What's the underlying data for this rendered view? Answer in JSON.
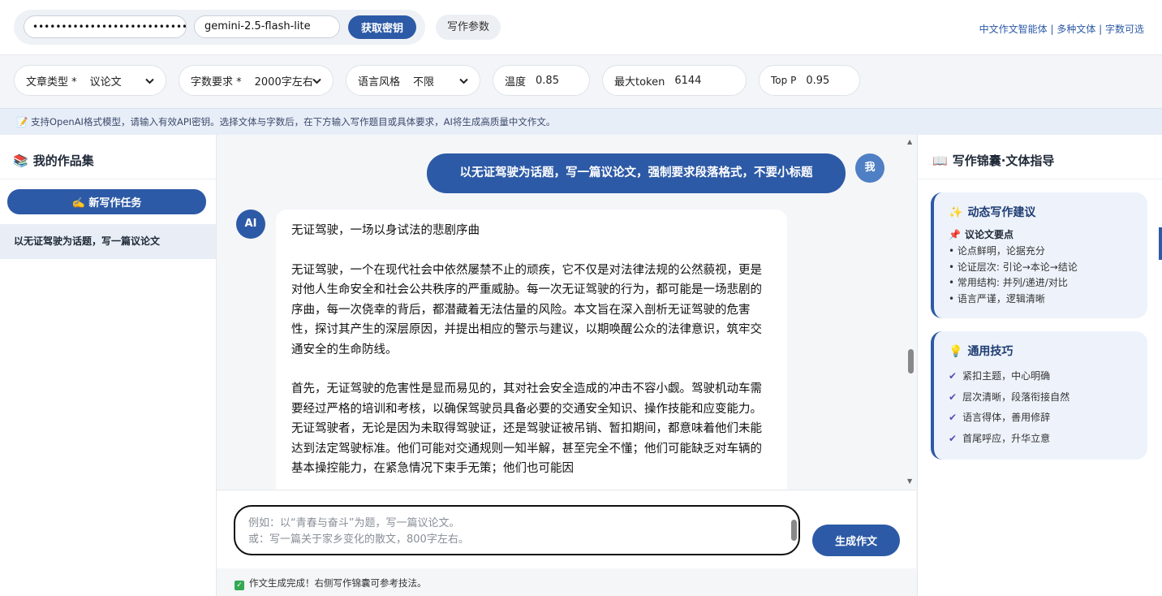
{
  "header": {
    "api_key_masked": "••••••••••••••••••••••••••••••••••••••",
    "model": "gemini-2.5-flash-lite",
    "get_key_label": "获取密钥",
    "params_label": "写作参数",
    "brand_tags": "中文作文智能体 | 多种文体 | 字数可选"
  },
  "settings": {
    "type_label": "文章类型 *",
    "type_value": "议论文",
    "words_label": "字数要求 *",
    "words_value": "2000字左右",
    "style_label": "语言风格",
    "style_value": "不限",
    "temp_label": "温度",
    "temp_value": "0.85",
    "maxtoken_label": "最大token",
    "maxtoken_value": "6144",
    "topp_label": "Top P",
    "topp_value": "0.95"
  },
  "note": "📝 支持OpenAI格式模型，请输入有效API密钥。选择文体与字数后，在下方输入写作题目或具体要求，AI将生成高质量中文作文。",
  "sidebar": {
    "title": "我的作品集",
    "new_task_label": "✍️ 新写作任务",
    "items": [
      {
        "label": "以无证驾驶为话题，写一篇议论文"
      }
    ]
  },
  "chat": {
    "user_avatar": "我",
    "ai_avatar": "AI",
    "user_message": "以无证驾驶为话题，写一篇议论文，强制要求段落格式，不要小标题",
    "ai_title": "无证驾驶，一场以身试法的悲剧序曲",
    "ai_paragraphs": [
      "无证驾驶，一个在现代社会中依然屡禁不止的顽疾，它不仅是对法律法规的公然藐视，更是对他人生命安全和社会公共秩序的严重威胁。每一次无证驾驶的行为，都可能是一场悲剧的序曲，每一次侥幸的背后，都潜藏着无法估量的风险。本文旨在深入剖析无证驾驶的危害性，探讨其产生的深层原因，并提出相应的警示与建议，以期唤醒公众的法律意识，筑牢交通安全的生命防线。",
      "首先，无证驾驶的危害性是显而易见的，其对社会安全造成的冲击不容小觑。驾驶机动车需要经过严格的培训和考核，以确保驾驶员具备必要的交通安全知识、操作技能和应变能力。无证驾驶者，无论是因为未取得驾驶证，还是驾驶证被吊销、暂扣期间，都意味着他们未能达到法定驾驶标准。他们可能对交通规则一知半解，甚至完全不懂；他们可能缺乏对车辆的基本操控能力，在紧急情况下束手无策；他们也可能因"
    ]
  },
  "composer": {
    "placeholder": "例如：以“青春与奋斗”为题，写一篇议论文。\n或：写一篇关于家乡变化的散文，800字左右。",
    "generate_label": "生成作文",
    "status": "作文生成完成！右侧写作锦囊可参考技法。"
  },
  "guide": {
    "title": "写作锦囊·文体指导",
    "dynamic": {
      "title": "动态写作建议",
      "subtitle": "议论文要点",
      "lines": [
        "• 论点鲜明，论据充分",
        "• 论证层次: 引论→本论→结论",
        "• 常用结构: 并列/递进/对比",
        "• 语言严谨，逻辑清晰"
      ]
    },
    "tips": {
      "title": "通用技巧",
      "lines": [
        "紧扣主题，中心明确",
        "层次清晰，段落衔接自然",
        "语言得体，善用修辞",
        "首尾呼应，升华立意"
      ]
    }
  },
  "colors": {
    "accent": "#2d5aa6",
    "success": "#34a853"
  }
}
